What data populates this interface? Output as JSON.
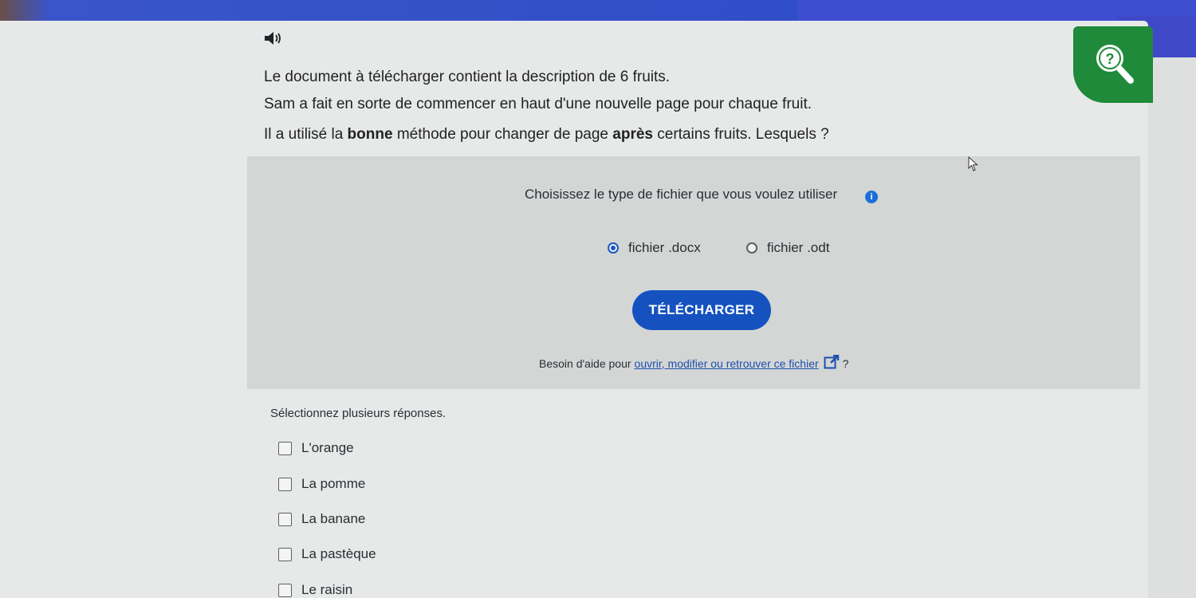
{
  "question": {
    "line1": "Le document à télécharger contient la description de 6 fruits.",
    "line2": "Sam a fait en sorte de commencer en haut d'une nouvelle page pour chaque fruit.",
    "line3_part1": "Il a utilisé la ",
    "line3_bold1": "bonne",
    "line3_part2": " méthode pour changer de page ",
    "line3_bold2": "après",
    "line3_part3": " certains fruits. Lesquels ?"
  },
  "download_panel": {
    "title": "Choisissez le type de fichier que vous voulez utiliser",
    "options": [
      {
        "label": "fichier .docx",
        "selected": true
      },
      {
        "label": "fichier .odt",
        "selected": false
      }
    ],
    "button_label": "TÉLÉCHARGER",
    "help_prefix": "Besoin d'aide pour",
    "help_link": "ouvrir, modifier ou retrouver ce fichier",
    "help_suffix": "?"
  },
  "answers": {
    "hint": "Sélectionnez plusieurs réponses.",
    "choices": [
      {
        "label": "L'orange",
        "checked": false
      },
      {
        "label": "La pomme",
        "checked": false
      },
      {
        "label": "La banane",
        "checked": false
      },
      {
        "label": "La pastèque",
        "checked": false
      },
      {
        "label": "Le raisin",
        "checked": false
      }
    ]
  },
  "icons": {
    "audio": "speaker-icon",
    "help": "help-magnifier-icon",
    "info": "info-icon",
    "external": "external-link-icon"
  },
  "colors": {
    "primary": "#1552c0",
    "help_badge": "#1f8a3a",
    "header": "#2f4ec8"
  }
}
